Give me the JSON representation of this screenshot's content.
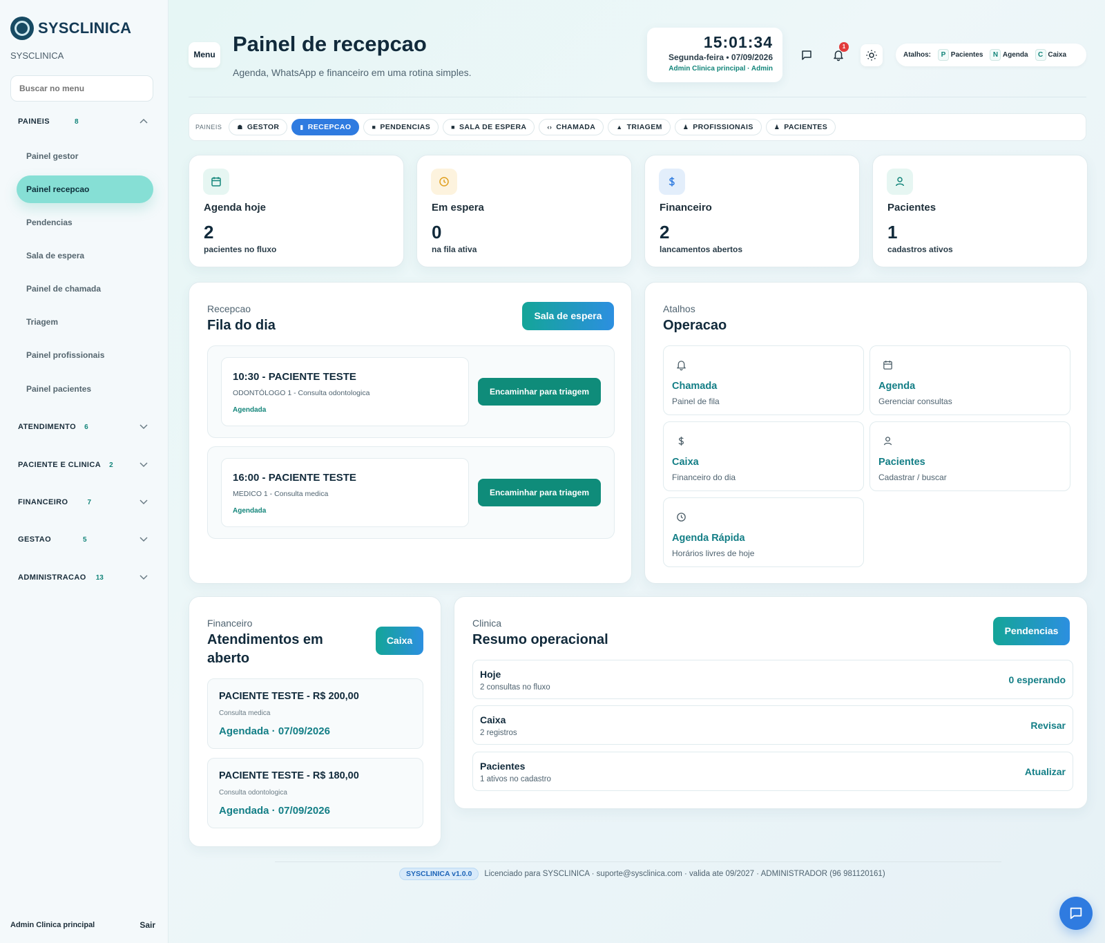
{
  "sidebar": {
    "brand": "SYSCLINICA",
    "subtitle": "SYSCLINICA",
    "search_placeholder": "Buscar no menu",
    "groups": [
      {
        "label": "PAINEIS",
        "count": "8",
        "expanded": true
      },
      {
        "label": "ATENDIMENTO",
        "count": "6"
      },
      {
        "label": "PACIENTE E CLINICA",
        "count": "2"
      },
      {
        "label": "FINANCEIRO",
        "count": "7"
      },
      {
        "label": "GESTAO",
        "count": "5"
      },
      {
        "label": "ADMINISTRACAO",
        "count": "13"
      }
    ],
    "items": [
      {
        "label": "Painel gestor"
      },
      {
        "label": "Painel recepcao",
        "active": true
      },
      {
        "label": "Pendencias"
      },
      {
        "label": "Sala de espera"
      },
      {
        "label": "Painel de chamada"
      },
      {
        "label": "Triagem"
      },
      {
        "label": "Painel profissionais"
      },
      {
        "label": "Painel pacientes"
      }
    ],
    "footer_user": "Admin Clinica principal",
    "logout": "Sair"
  },
  "header": {
    "menu_label": "Menu",
    "title": "Painel de recepcao",
    "subtitle": "Agenda, WhatsApp e financeiro em uma rotina simples.",
    "clock": {
      "time": "15:01:34",
      "date": "Segunda-feira • 07/09/2026",
      "user": "Admin Clinica principal · Admin"
    },
    "notifications_count": "1",
    "shortcuts": {
      "label": "Atalhos:",
      "items": [
        {
          "key": "P",
          "label": "Pacientes"
        },
        {
          "key": "N",
          "label": "Agenda"
        },
        {
          "key": "C",
          "label": "Caixa"
        }
      ]
    }
  },
  "tabs": {
    "label": "PAINEIS",
    "items": [
      {
        "label": "GESTOR",
        "icon": "home-icon"
      },
      {
        "label": "RECEPCAO",
        "icon": "bookmark-icon",
        "active": true
      },
      {
        "label": "PENDENCIAS",
        "icon": "document-icon"
      },
      {
        "label": "SALA DE ESPERA",
        "icon": "square-icon"
      },
      {
        "label": "CHAMADA",
        "icon": "arrows-icon"
      },
      {
        "label": "TRIAGEM",
        "icon": "triangle-icon"
      },
      {
        "label": "PROFISSIONAIS",
        "icon": "users-icon"
      },
      {
        "label": "PACIENTES",
        "icon": "user-icon"
      }
    ]
  },
  "stats": [
    {
      "title": "Agenda hoje",
      "value": "2",
      "sub": "pacientes no fluxo",
      "icon": "calendar-icon",
      "color": "#13857a",
      "bg": "#e6f6f2"
    },
    {
      "title": "Em espera",
      "value": "0",
      "sub": "na fila ativa",
      "icon": "clock-icon",
      "color": "#e0a020",
      "bg": "#fdf3de"
    },
    {
      "title": "Financeiro",
      "value": "2",
      "sub": "lancamentos abertos",
      "icon": "dollar-icon",
      "color": "#2f7be0",
      "bg": "#e3eefb"
    },
    {
      "title": "Pacientes",
      "value": "1",
      "sub": "cadastros ativos",
      "icon": "user-icon",
      "color": "#13857a",
      "bg": "#e6f6f2"
    }
  ],
  "queue": {
    "kicker": "Recepcao",
    "title": "Fila do dia",
    "action": "Sala de espera",
    "items": [
      {
        "title": "10:30 - PACIENTE TESTE",
        "sub": "ODONTÓLOGO 1 - Consulta odontologica",
        "status": "Agendada",
        "button": "Encaminhar para triagem"
      },
      {
        "title": "16:00 - PACIENTE TESTE",
        "sub": "MEDICO 1 - Consulta medica",
        "status": "Agendada",
        "button": "Encaminhar para triagem"
      }
    ]
  },
  "operations": {
    "kicker": "Atalhos",
    "title": "Operacao",
    "items": [
      {
        "title": "Chamada",
        "sub": "Painel de fila",
        "icon": "bell-icon"
      },
      {
        "title": "Agenda",
        "sub": "Gerenciar consultas",
        "icon": "calendar-icon"
      },
      {
        "title": "Caixa",
        "sub": "Financeiro do dia",
        "icon": "dollar-icon"
      },
      {
        "title": "Pacientes",
        "sub": "Cadastrar / buscar",
        "icon": "user-icon"
      },
      {
        "title": "Agenda Rápida",
        "sub": "Horários livres de hoje",
        "icon": "clock-icon"
      }
    ]
  },
  "financial": {
    "kicker": "Financeiro",
    "title_line1": "Atendimentos em",
    "title_line2": "aberto",
    "action": "Caixa",
    "items": [
      {
        "title": "PACIENTE TESTE - R$ 200,00",
        "sub": "Consulta medica",
        "status": "Agendada · 07/09/2026"
      },
      {
        "title": "PACIENTE TESTE - R$ 180,00",
        "sub": "Consulta odontologica",
        "status": "Agendada · 07/09/2026"
      }
    ]
  },
  "summary": {
    "kicker": "Clinica",
    "title": "Resumo operacional",
    "action": "Pendencias",
    "rows": [
      {
        "title": "Hoje",
        "sub": "2 consultas no fluxo",
        "link": "0 esperando"
      },
      {
        "title": "Caixa",
        "sub": "2 registros",
        "link": "Revisar"
      },
      {
        "title": "Pacientes",
        "sub": "1 ativos no cadastro",
        "link": "Atualizar"
      }
    ]
  },
  "footer": {
    "version": "SYSCLINICA v1.0.0",
    "text": "Licenciado para SYSCLINICA · suporte@sysclinica.com · valida ate 09/2027 · ADMINISTRADOR (96 981120161)"
  }
}
